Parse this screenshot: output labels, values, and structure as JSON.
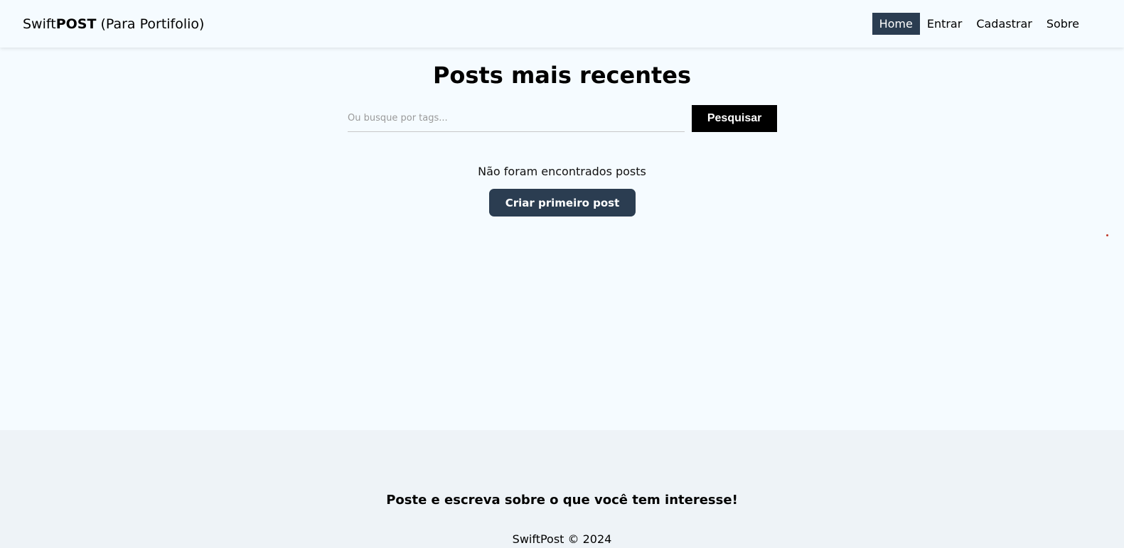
{
  "header": {
    "brand_prefix": "Swift",
    "brand_strong": "POST",
    "brand_suffix": " (Para Portifolio)",
    "nav": [
      {
        "label": "Home",
        "active": true
      },
      {
        "label": "Entrar",
        "active": false
      },
      {
        "label": "Cadastrar",
        "active": false
      },
      {
        "label": "Sobre",
        "active": false
      }
    ]
  },
  "main": {
    "title": "Posts mais recentes",
    "search": {
      "placeholder": "Ou busque por tags...",
      "value": "",
      "button_label": "Pesquisar"
    },
    "empty_message": "Não foram encontrados posts",
    "create_button_label": "Criar primeiro post"
  },
  "footer": {
    "tagline": "Poste e escreva sobre o que você tem interesse!",
    "copyright": "SwiftPost © 2024"
  },
  "colors": {
    "page_bg": "#f5fbff",
    "footer_bg": "#eef3f7",
    "accent": "#2b3d51",
    "search_button_bg": "#000000"
  }
}
